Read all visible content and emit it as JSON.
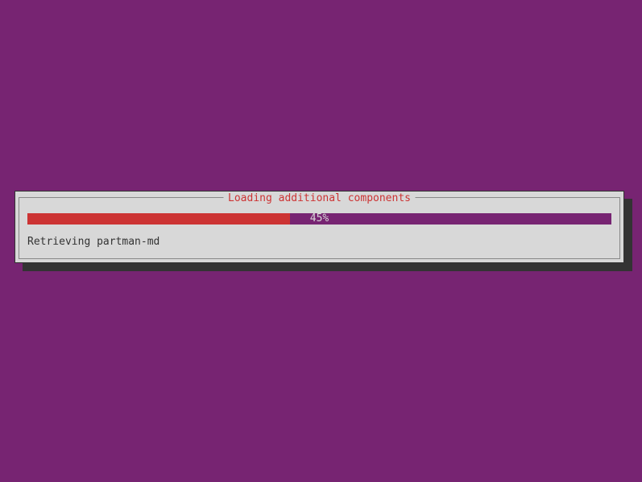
{
  "dialog": {
    "title": "Loading additional components",
    "progress": {
      "percent": 45,
      "label": "45%"
    },
    "status": "Retrieving partman-md"
  },
  "colors": {
    "background": "#772472",
    "dialog_bg": "#d8d8d8",
    "title_fg": "#cc3333",
    "progress_fill": "#cc3333",
    "progress_track": "#772472"
  }
}
